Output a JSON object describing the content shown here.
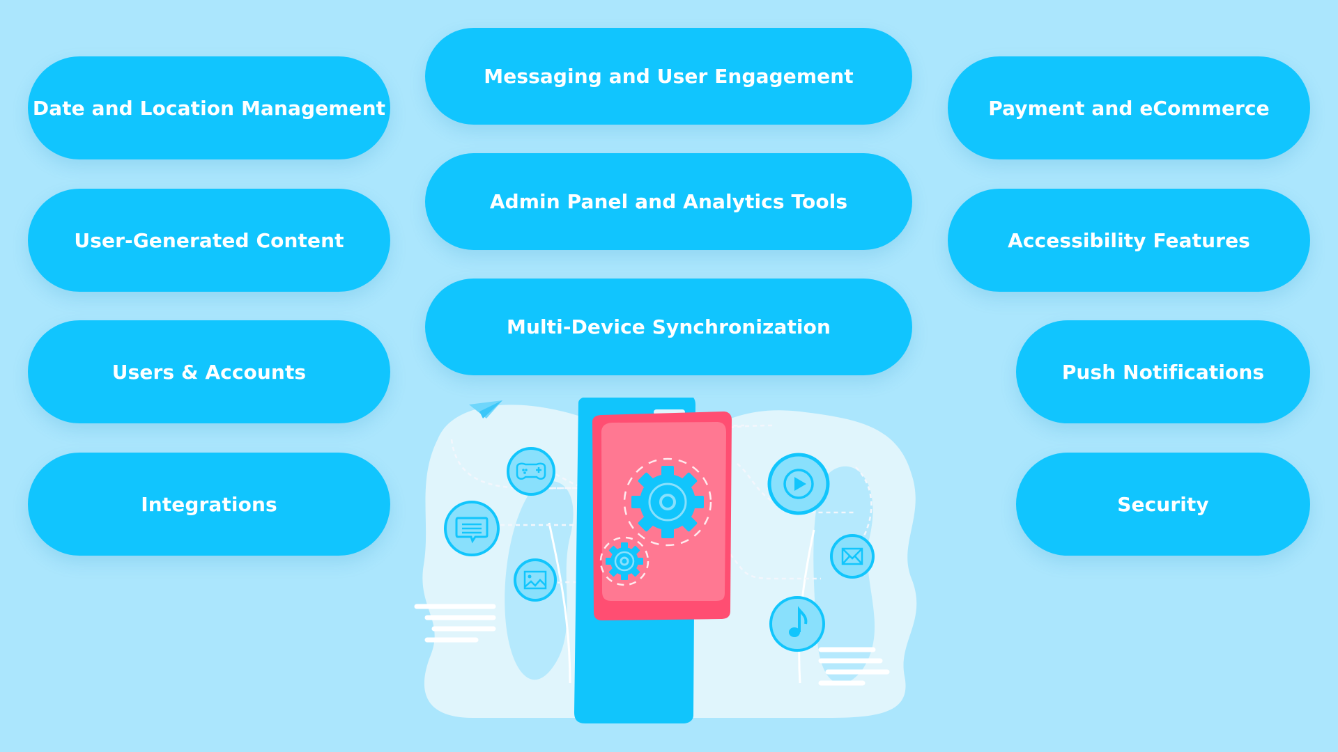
{
  "colors": {
    "background": "#abe6fd",
    "pill": "#11c5fe",
    "pill_text": "#ffffff",
    "phone_body": "#11c5fc",
    "phone_screen": "#ff4e72",
    "phone_screen_inner": "#ff7892",
    "blob": "#e0f5fc",
    "icon_fill": "#89e0fc"
  },
  "features": {
    "left": [
      {
        "label": "Date and Location Management"
      },
      {
        "label": "User-Generated Content"
      },
      {
        "label": "Users & Accounts"
      },
      {
        "label": "Integrations"
      }
    ],
    "middle": [
      {
        "label": "Messaging and User Engagement"
      },
      {
        "label": "Admin Panel and Analytics Tools"
      },
      {
        "label": "Multi-Device Synchronization"
      }
    ],
    "right": [
      {
        "label": "Payment and eCommerce"
      },
      {
        "label": "Accessibility Features"
      },
      {
        "label": "Push Notifications"
      },
      {
        "label": "Security"
      }
    ]
  },
  "illustration": {
    "subject": "smartphone-with-app-feature-icons",
    "icons": [
      "paper-plane-icon",
      "gamepad-icon",
      "chat-icon",
      "image-icon",
      "gear-icon",
      "play-icon",
      "mail-icon",
      "music-note-icon"
    ]
  }
}
